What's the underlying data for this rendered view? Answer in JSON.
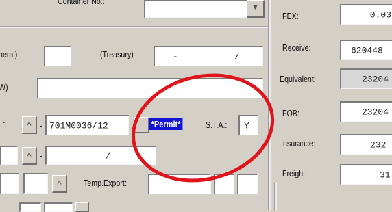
{
  "top": {
    "container_label": "Container No.:"
  },
  "row1": {
    "general_label": "neral)",
    "treasury_label": "(Treasury)",
    "treasury_value": "-",
    "treasury_sep": "/"
  },
  "row2": {
    "w_label": "W)"
  },
  "row3": {
    "left_value": "1",
    "up_arrow": "^",
    "dash": "-",
    "permit_no": "701M0036/12",
    "permit_label": "*Permit*",
    "sta_label": "S.T.A.:",
    "sta_value": "Y"
  },
  "row4": {
    "up_arrow": "^",
    "dash": "-",
    "slash": "/"
  },
  "row5": {
    "up_arrow": "^",
    "temp_export_label": "Temp.Export:"
  },
  "right": {
    "fex": {
      "label": "FEX:",
      "value": "0.03"
    },
    "receive": {
      "label": "Receive:",
      "value": "620448"
    },
    "equivalent": {
      "label": "Equivalent:",
      "value": "23204"
    },
    "fob": {
      "label": "FOB:",
      "value": "23204"
    },
    "insurance": {
      "label": "Insurance:",
      "value": "232"
    },
    "freight": {
      "label": "Freight:",
      "value": "31"
    }
  },
  "annotation_color": "#e0141a"
}
